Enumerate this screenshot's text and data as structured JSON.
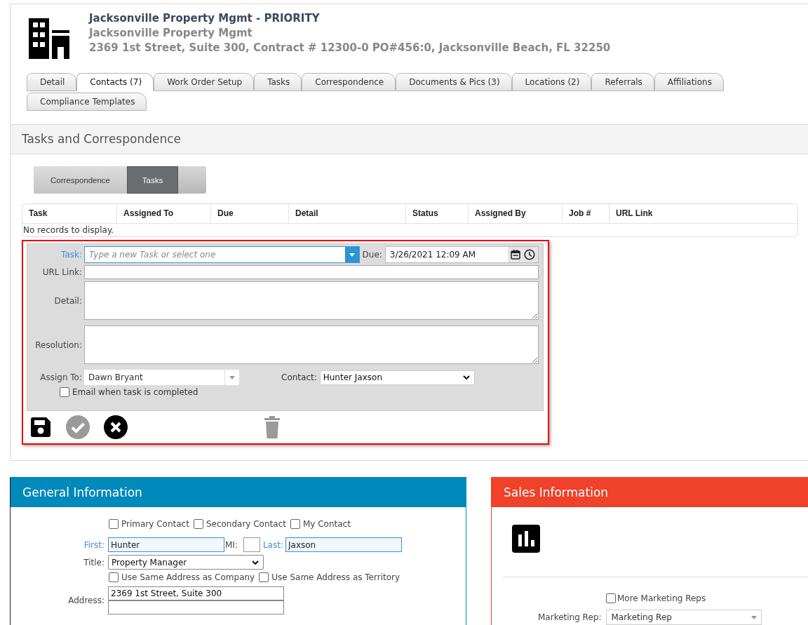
{
  "header": {
    "title": "Jacksonville Property Mgmt - PRIORITY",
    "company": "Jacksonville Property Mgmt",
    "address": "2369 1st Street, Suite 300, Contract # 12300-0 PO#456:0, Jacksonville Beach, FL 32250"
  },
  "tabs": [
    {
      "label": "Detail",
      "selected": false
    },
    {
      "label": "Contacts (7)",
      "selected": true
    },
    {
      "label": "Work Order Setup",
      "selected": false
    },
    {
      "label": "Tasks",
      "selected": false
    },
    {
      "label": "Correspondence",
      "selected": false
    },
    {
      "label": "Documents & Pics (3)",
      "selected": false
    },
    {
      "label": "Locations (2)",
      "selected": false
    },
    {
      "label": "Referrals",
      "selected": false
    },
    {
      "label": "Affiliations",
      "selected": false
    },
    {
      "label": "Compliance Templates",
      "selected": false
    }
  ],
  "tasks_panel": {
    "title": "Tasks and Correspondence",
    "toggle": [
      {
        "label": "Correspondence",
        "selected": false
      },
      {
        "label": "Tasks",
        "selected": true
      }
    ],
    "grid": {
      "columns": [
        "Task",
        "Assigned To",
        "Due",
        "Detail",
        "Status",
        "Assigned By",
        "Job #",
        "URL Link"
      ],
      "empty_message": "No records to display."
    },
    "form": {
      "task_label": "Task:",
      "task_placeholder": "Type a new Task or select one",
      "due_label": "Due:",
      "due_value": "3/26/2021 12:09 AM",
      "url_label": "URL Link:",
      "detail_label": "Detail:",
      "resolution_label": "Resolution:",
      "assign_label": "Assign To:",
      "assign_value": "Dawn Bryant",
      "contact_label": "Contact:",
      "contact_value": "Hunter Jaxson",
      "email_checkbox": {
        "label": "Email when task is completed",
        "checked": false
      },
      "actions": [
        {
          "kind": "save",
          "disabled": false
        },
        {
          "kind": "complete",
          "disabled": true
        },
        {
          "kind": "cancel",
          "disabled": false
        },
        {
          "kind": "delete",
          "disabled": true
        }
      ]
    }
  },
  "general": {
    "title": "General Information",
    "contact_types": [
      {
        "label": "Primary Contact",
        "checked": false
      },
      {
        "label": "Secondary Contact",
        "checked": false
      },
      {
        "label": "My Contact",
        "checked": false
      }
    ],
    "first_label": "First:",
    "first_value": "Hunter",
    "mi_label": "MI:",
    "last_label": "Last:",
    "last_value": "Jaxson",
    "title_label": "Title:",
    "title_value": "Property Manager",
    "address_options": [
      {
        "label": "Use Same Address as Company",
        "checked": false
      },
      {
        "label": "Use Same Address as Territory",
        "checked": false
      }
    ],
    "address_label": "Address:",
    "address_line1": "2369 1st Street, Suite 300"
  },
  "sales": {
    "title": "Sales Information",
    "more_reps": {
      "label": "More Marketing Reps",
      "checked": false
    },
    "marketing_rep_label": "Marketing Rep:",
    "marketing_rep_value": "Marketing Rep"
  }
}
